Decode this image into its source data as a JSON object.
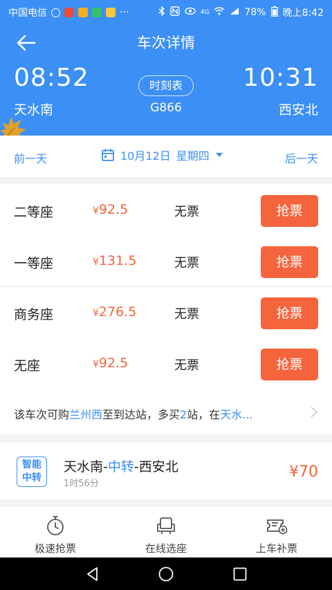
{
  "status_bar": {
    "carrier": "中国电信",
    "battery": "78%",
    "time": "晚上8:42",
    "more": "···",
    "network": "4G"
  },
  "header": {
    "title": "车次详情",
    "depart_time": "08:52",
    "arrive_time": "10:31",
    "from_station": "天水南",
    "to_station": "西安北",
    "timetable_label": "时刻表",
    "train_no": "G866"
  },
  "date_bar": {
    "prev_label": "前一天",
    "next_label": "后一天",
    "date": "10月12日",
    "weekday": "星期四"
  },
  "currency_symbol": "¥",
  "seats": [
    {
      "name": "二等座",
      "price": "92.5",
      "status": "无票",
      "button": "抢票"
    },
    {
      "name": "一等座",
      "price": "131.5",
      "status": "无票",
      "button": "抢票"
    },
    {
      "name": "商务座",
      "price": "276.5",
      "status": "无票",
      "button": "抢票"
    },
    {
      "name": "无座",
      "price": "92.5",
      "status": "无票",
      "button": "抢票"
    }
  ],
  "tip": {
    "p1": "该车次可购",
    "station": "兰州西",
    "p2": "至到达站，多买",
    "count": "2",
    "p3": "站，在",
    "tail": "天水..."
  },
  "transfer": {
    "badge_line1": "智能",
    "badge_line2": "中转",
    "from": "天水南",
    "dash1": "-",
    "via": "中转",
    "dash2": "-",
    "to": "西安北",
    "duration": "1时56分",
    "price": "¥70"
  },
  "tabs": [
    {
      "label": "极速抢票",
      "icon": "stopwatch-icon"
    },
    {
      "label": "在线选座",
      "icon": "seat-icon"
    },
    {
      "label": "上车补票",
      "icon": "ticket-add-icon"
    }
  ],
  "colors": {
    "primary": "#3b8ff5",
    "accent": "#f5643c"
  }
}
